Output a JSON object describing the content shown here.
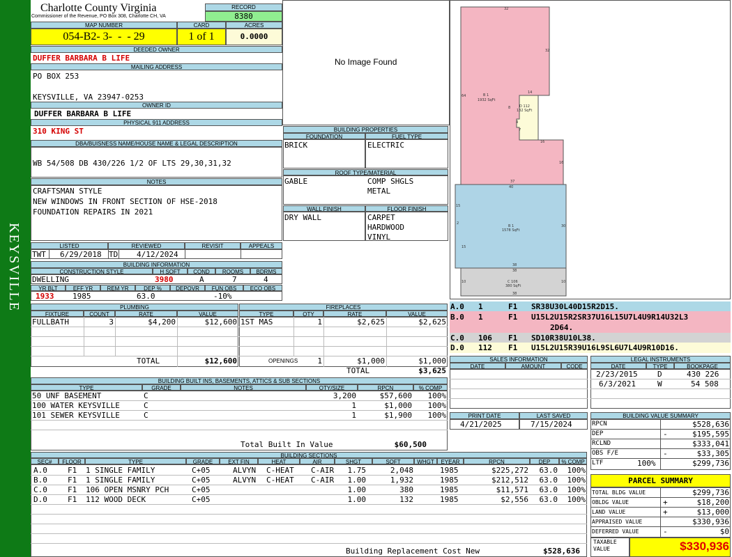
{
  "sidebar": {
    "label": "KEYSVILLE"
  },
  "header": {
    "county": "Charlotte County Virginia",
    "commissioner": "Commissioner of the Revenue, PO Box 308, Charlotte CH, VA",
    "record_label": "RECORD",
    "record": "8380"
  },
  "parcel": {
    "map_number_label": "MAP NUMBER",
    "map_number": "054-B2- 3-  -  - 29",
    "card_label": "CARD",
    "card": "1 of 1",
    "acres_label": "ACRES",
    "acres": "0.0000"
  },
  "deeded_owner": {
    "label": "DEEDED OWNER",
    "value": "DUFFER BARBARA B LIFE"
  },
  "mailing": {
    "label": "MAILING ADDRESS",
    "line1": "PO BOX 253",
    "line2": "KEYSVILLE, VA 23947-0253"
  },
  "owner_id": {
    "label": "OWNER ID",
    "value": "DUFFER BARBARA B LIFE"
  },
  "physical": {
    "label": "PHYSICAL 911 ADDRESS",
    "value": "310 KING ST"
  },
  "legal": {
    "label": "DBA/BUISNESS NAME/HOUSE NAME & LEGAL DESCRIPTION",
    "value": "WB 54/508 DB 430/226 1/2 OF LTS 29,30,31,32"
  },
  "notes": {
    "label": "NOTES",
    "lines": [
      "CRAFTSMAN STYLE",
      "NEW WINDOWS IN FRONT SECTION OF HSE-2018",
      "FOUNDATION REPAIRS IN 2021"
    ]
  },
  "photo": {
    "text": "No Image Found"
  },
  "building_properties": {
    "label": "BUILDING PROPERTIES",
    "foundation_label": "FOUNDATION",
    "foundation": "BRICK",
    "fuel_label": "FUEL TYPE",
    "fuel": "ELECTRIC",
    "roof_label": "ROOF TYPE/MATERIAL",
    "roof_type": "GABLE",
    "roof_material": [
      "COMP SHGLS",
      "METAL"
    ],
    "wall_label": "WALL FINISH",
    "wall": "DRY WALL",
    "floor_label": "FLOOR FINISH",
    "floor": [
      "CARPET",
      "HARDWOOD",
      "VINYL"
    ]
  },
  "status": {
    "listed_label": "LISTED",
    "listed_by": "TWT",
    "listed_date": "6/29/2018",
    "reviewed_label": "REVIEWED",
    "reviewed_by": "TD",
    "reviewed_date": "4/12/2024",
    "revisit_label": "REVISIT",
    "appeals_label": "APPEALS"
  },
  "building_info": {
    "label": "BUILDING INFORMATION",
    "style_label": "CONSTRUCTION STYLE",
    "style": "DWELLING",
    "hsqft_label": "H SQFT",
    "hsqft": "3980",
    "cond_label": "COND",
    "cond": "A",
    "rooms_label": "ROOMS",
    "rooms": "7",
    "bdrms_label": "BDRMS",
    "bdrms": "4",
    "yrblt_label": "YR BLT",
    "yrblt": "1933",
    "effyr_label": "EFF YR",
    "effyr": "1985",
    "remyr_label": "REM YR",
    "remyr": "",
    "dep_label": "DEP %",
    "dep": "63.0",
    "depovr_label": "DEPOVR",
    "depovr": "",
    "funobs_label": "FUN OBS",
    "funobs": "-10%",
    "ecoobs_label": "ECO OBS",
    "ecoobs": ""
  },
  "plumbing": {
    "label": "PLUMBING",
    "headers": [
      "FIXTURE",
      "COUNT",
      "RATE",
      "VALUE"
    ],
    "rows": [
      {
        "fixture": "FULLBATH",
        "count": "3",
        "rate": "$4,200",
        "value": "$12,600"
      }
    ],
    "total_label": "TOTAL",
    "total": "$12,600"
  },
  "fireplaces": {
    "label": "FIREPLACES",
    "headers": [
      "TYPE",
      "QTY",
      "RATE",
      "VALUE"
    ],
    "rows": [
      {
        "type": "1ST MAS",
        "qty": "1",
        "rate": "$2,625",
        "value": "$2,625"
      }
    ],
    "openings_label": "OPENINGS",
    "openings_qty": "1",
    "openings_rate": "$1,000",
    "openings_value": "$1,000",
    "total_label": "TOTAL",
    "total": "$3,625"
  },
  "built_ins": {
    "label": "BUILDING BUILT INS, BASEMENTS, ATTICS & SUB SECTIONS",
    "headers": [
      "TYPE",
      "GRADE",
      "NOTES",
      "QTY/SIZE",
      "RPCN",
      "% COMP"
    ],
    "rows": [
      {
        "type": "50 UNF BASEMENT",
        "grade": "C",
        "notes": "",
        "qty": "3,200",
        "rpcn": "$57,600",
        "comp": "100%"
      },
      {
        "type": "100 WATER KEYSVILLE",
        "grade": "C",
        "notes": "",
        "qty": "1",
        "rpcn": "$1,000",
        "comp": "100%"
      },
      {
        "type": "101 SEWER KEYSVILLE",
        "grade": "C",
        "notes": "",
        "qty": "1",
        "rpcn": "$1,900",
        "comp": "100%"
      }
    ],
    "total_label": "Total Built In Value",
    "total": "$60,500"
  },
  "sections": {
    "label": "BUILDING SECTIONS",
    "headers": [
      "SEC#",
      "FLOOR",
      "TYPE",
      "GRADE",
      "EXT FIN",
      "HEAT",
      "AIR",
      "SHGT",
      "SQFT",
      "WHGT",
      "EYEAR",
      "RPCN",
      "DEP",
      "% COMP"
    ],
    "rows": [
      {
        "sec": "A.0",
        "floor": "F1",
        "type": "1 SINGLE FAMILY",
        "grade": "C+05",
        "ext": "ALVYN",
        "heat": "C-HEAT",
        "air": "C-AIR",
        "shgt": "1.75",
        "sqft": "2,048",
        "whgt": "",
        "eyear": "1985",
        "rpcn": "$225,272",
        "dep": "63.0",
        "comp": "100%"
      },
      {
        "sec": "B.0",
        "floor": "F1",
        "type": "1 SINGLE FAMILY",
        "grade": "C+05",
        "ext": "ALVYN",
        "heat": "C-HEAT",
        "air": "C-AIR",
        "shgt": "1.00",
        "sqft": "1,932",
        "whgt": "",
        "eyear": "1985",
        "rpcn": "$212,512",
        "dep": "63.0",
        "comp": "100%"
      },
      {
        "sec": "C.0",
        "floor": "F1",
        "type": "106 OPEN MSNRY PCH",
        "grade": "C+05",
        "ext": "",
        "heat": "",
        "air": "",
        "shgt": "1.00",
        "sqft": "380",
        "whgt": "",
        "eyear": "1985",
        "rpcn": "$11,571",
        "dep": "63.0",
        "comp": "100%"
      },
      {
        "sec": "D.0",
        "floor": "F1",
        "type": "112 WOOD DECK",
        "grade": "C+05",
        "ext": "",
        "heat": "",
        "air": "",
        "shgt": "1.00",
        "sqft": "132",
        "whgt": "",
        "eyear": "1985",
        "rpcn": "$2,556",
        "dep": "63.0",
        "comp": "100%"
      }
    ],
    "total_label": "Building Replacement Cost New",
    "total": "$528,636"
  },
  "sketch": {
    "dims": {
      "a_top": "32",
      "a_right_top": "32",
      "a_mid": "14",
      "a_left": "64",
      "a_r8": "8",
      "a_r4": "4",
      "a_r7": "7",
      "a_r16": "16",
      "a_rr16": "16",
      "a_bottom": "37",
      "b_top": "40",
      "b_left": "15",
      "b_l2": "2",
      "b_right": "30",
      "b_l15": "15",
      "b_bot": "38",
      "c_top": "38",
      "c_left": "10",
      "c_right": "10",
      "c_bot": "38"
    },
    "labels": {
      "a": "B 1",
      "a_area": "1932 SqFt",
      "d": "D 112",
      "d_area": "132 SqFt",
      "b": "B 1",
      "b_area": "1578 SqFt",
      "c": "C 106",
      "c_area": "380 SqFt"
    },
    "colors": {
      "a": "#f4b6c2",
      "b": "#aed4e6",
      "c": "#d3d3d3",
      "d": "#fdfbd8"
    }
  },
  "codes": [
    {
      "id": "A.0",
      "n": "1",
      "f": "F1",
      "code": "SR38U30L40D15R2D15.",
      "bg": "#add8e6"
    },
    {
      "id": "B.0",
      "n": "1",
      "f": "F1",
      "code": "U15L2U15R2SR37U16L15U7L4U9R14U32L3",
      "code2": "2D64.",
      "bg": "#f4b6c2"
    },
    {
      "id": "C.0",
      "n": "106",
      "f": "F1",
      "code": "SD10R38U10L38.",
      "bg": "#d3d3d3"
    },
    {
      "id": "D.0",
      "n": "112",
      "f": "F1",
      "code": "U15L2U15R39U16L9SL6U7L4U9R10D16.",
      "bg": "#fdfbd8"
    }
  ],
  "sales": {
    "label": "SALES INFORMATION",
    "headers": [
      "DATE",
      "AMOUNT",
      "CODE"
    ]
  },
  "legal_instruments": {
    "label": "LEGAL INSTRUMENTS",
    "headers": [
      "DATE",
      "TYPE",
      "BOOKPAGE"
    ],
    "rows": [
      {
        "date": "2/23/2015",
        "type": "D",
        "book": "430 226"
      },
      {
        "date": "6/3/2021",
        "type": "W",
        "book": "54 508"
      }
    ]
  },
  "print": {
    "print_label": "PRINT DATE",
    "print_date": "4/21/2025",
    "saved_label": "LAST SAVED",
    "saved_date": "7/15/2024"
  },
  "value_summary": {
    "label": "BUILDING VALUE SUMMARY",
    "rows": [
      {
        "label": "RPCN",
        "sign": "",
        "value": "$528,636"
      },
      {
        "label": "DEP",
        "sign": "-",
        "value": "$195,595"
      },
      {
        "label": "RCLND",
        "sign": "",
        "value": "$333,041"
      },
      {
        "label": "OBS F/E",
        "sign": "-",
        "value": "$33,305"
      },
      {
        "label": "LTF",
        "pct": "100%",
        "sign": "",
        "value": "$299,736"
      }
    ]
  },
  "parcel_summary": {
    "label": "PARCEL SUMMARY",
    "rows": [
      {
        "label": "TOTAL BLDG VALUE",
        "sign": "",
        "value": "$299,736"
      },
      {
        "label": "OBLDG VALUE",
        "sign": "+",
        "value": "$18,200"
      },
      {
        "label": "LAND VALUE",
        "sign": "+",
        "value": "$13,000"
      },
      {
        "label": "APPRAISED VALUE",
        "sign": "",
        "value": "$330,936"
      },
      {
        "label": "DEFERRED VALUE",
        "sign": "-",
        "value": "$0"
      }
    ],
    "taxable_label": "TAXABLE VALUE",
    "taxable": "$330,936"
  }
}
